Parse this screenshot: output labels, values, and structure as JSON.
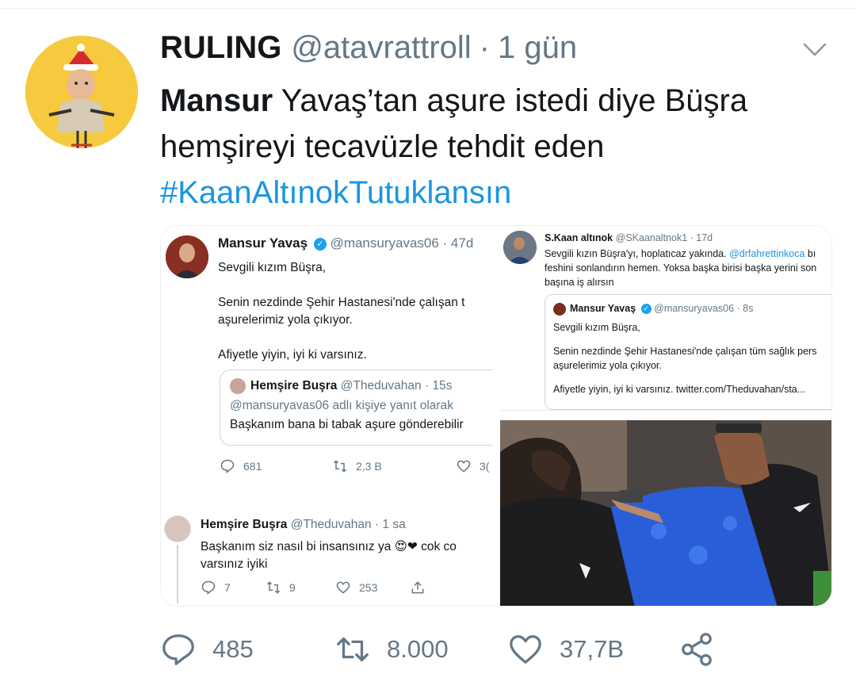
{
  "tweet": {
    "display_name": "RULING",
    "handle": "@atavrattroll",
    "separator": "·",
    "time": "1 gün",
    "text_bold": "Mansur",
    "text_rest": " Yavaş’tan aşure istedi diye Büşra hemşireyi tecavüzle tehdit eden",
    "hashtag": "#KaanAltınokTutuklansın"
  },
  "screenshot_left": {
    "author_name": "Mansur Yavaş",
    "author_handle": "@mansuryavas06 · 47d",
    "line1": "Sevgili kızım Büşra,",
    "line2": "Senin nezdinde Şehir Hastanesi'nde çalışan t",
    "line3": "aşurelerimiz yola çıkıyor.",
    "line4": "Afiyetle yiyin, iyi ki varsınız.",
    "quote_name": "Hemşire Buşra",
    "quote_handle": "@Theduvahan · 15s",
    "quote_reply_to": "@mansuryavas06 adlı kişiye yanıt olarak",
    "quote_text": "Başkanım bana bi tabak aşure gönderebilir",
    "reply_count": "681",
    "retweet_count": "2,3 B",
    "like_count": "3(",
    "reply_name": "Hemşire Buşra",
    "reply_handle": "@Theduvahan · 1 sa",
    "reply_line1": "Başkanım siz nasıl bi insansınız ya",
    "reply_emoji": "😍❤",
    "reply_line1_end": " cok co",
    "reply_line2": "varsınız iyiki",
    "reply_replies": "7",
    "reply_retweets": "9",
    "reply_likes": "253"
  },
  "screenshot_right": {
    "author_name": "S.Kaan altınok",
    "author_handle": "@SKaanaltnok1 · 17d",
    "line1_a": "Sevgili kızın Büşra'yı, hoplatıcaz yakında. ",
    "line1_mention": "@drfahrettinkoca",
    "line1_b": " bı",
    "line2": "feshini sonlandırın hemen. Yoksa başka birisi başka yerini son",
    "line3": "başına iş alırsın",
    "quote_name": "Mansur Yavaş",
    "quote_handle": "@mansuryavas06 · 8s",
    "quote_line1": "Sevgili kızım Büşra,",
    "quote_line2": "Senin nezdinde Şehir Hastanesi'nde çalışan tüm sağlık pers",
    "quote_line3": "aşurelerimiz yola çıkıyor.",
    "quote_line4": "Afiyetle yiyin, iyi ki varsınız. twitter.com/Theduvahan/sta..."
  },
  "actions": {
    "reply_count": "485",
    "retweet_count": "8.000",
    "like_count": "37,7B"
  },
  "icons": {
    "reply": "reply-icon",
    "retweet": "retweet-icon",
    "like": "heart-icon",
    "share": "share-icon",
    "more": "chevron-down-icon",
    "verified": "verified-badge-icon"
  },
  "colors": {
    "link": "#1b95e0",
    "secondary_text": "#657786",
    "primary_text": "#14171a",
    "avatar_bg": "#f7c93e"
  }
}
